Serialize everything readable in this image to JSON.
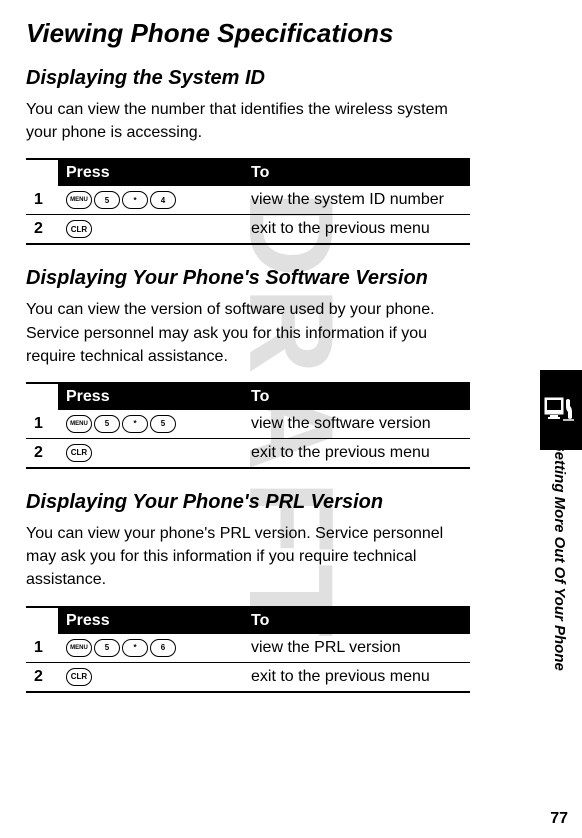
{
  "watermark": "DRAFT",
  "heading": "Viewing Phone Specifications",
  "section1": {
    "title": "Displaying the System ID",
    "body": "You can view the number that identifies the wireless system your phone is accessing.",
    "table": {
      "col1": "Press",
      "col2": "To",
      "row1": {
        "num": "1",
        "keys": [
          "MENU",
          "5",
          "*",
          "4"
        ],
        "desc": "view the system ID number"
      },
      "row2": {
        "num": "2",
        "keys": [
          "CLR"
        ],
        "desc": "exit to the previous menu"
      }
    }
  },
  "section2": {
    "title": "Displaying Your Phone's Software Version",
    "body": "You can view the version of software used by your phone. Service personnel may ask you for this information if you require technical assistance.",
    "table": {
      "col1": "Press",
      "col2": "To",
      "row1": {
        "num": "1",
        "keys": [
          "MENU",
          "5",
          "*",
          "5"
        ],
        "desc": "view the software version"
      },
      "row2": {
        "num": "2",
        "keys": [
          "CLR"
        ],
        "desc": "exit to the previous menu"
      }
    }
  },
  "section3": {
    "title": "Displaying Your Phone's PRL Version",
    "body": "You can view your phone's PRL version. Service personnel may ask you for this information if you require technical assistance.",
    "table": {
      "col1": "Press",
      "col2": "To",
      "row1": {
        "num": "1",
        "keys": [
          "MENU",
          "5",
          "*",
          "6"
        ],
        "desc": "view the PRL version"
      },
      "row2": {
        "num": "2",
        "keys": [
          "CLR"
        ],
        "desc": "exit to the previous menu"
      }
    }
  },
  "sidebar_label": "Getting More Out Of Your Phone",
  "page_number": "77"
}
